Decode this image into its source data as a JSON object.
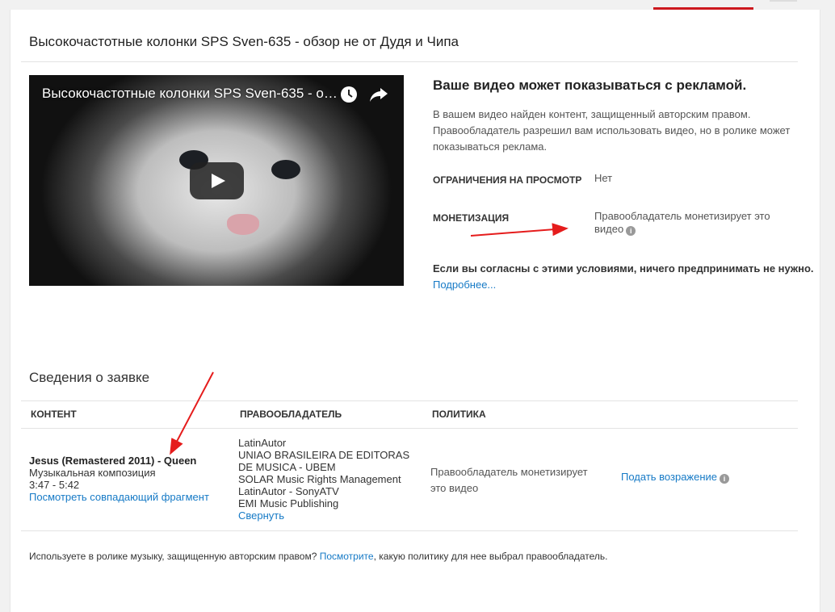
{
  "page": {
    "title": "Высокочастотные колонки SPS Sven-635 - обзор не от Дудя и Чипа"
  },
  "video": {
    "title": "Высокочастотные колонки SPS Sven-635 - обзор не от Дудя и Чипа",
    "icons": [
      "clock-icon",
      "share-icon",
      "play-icon"
    ]
  },
  "ad_notice": {
    "heading": "Ваше видео может показываться с рекламой.",
    "description": "В вашем видео найден контент, защищенный авторским правом. Правообладатель разрешил вам использовать видео, но в ролике может показываться реклама.",
    "restrictions_label": "ОГРАНИЧЕНИЯ НА ПРОСМОТР",
    "restrictions_value": "Нет",
    "monetization_label": "МОНЕТИЗАЦИЯ",
    "monetization_value": "Правообладатель монетизирует это видео",
    "agree_text": "Если вы согласны с этими условиями, ничего предпринимать не нужно.",
    "more_link": "Подробнее..."
  },
  "claim": {
    "section_title": "Сведения о заявке",
    "headers": {
      "content": "КОНТЕНТ",
      "owner": "ПРАВООБЛАДАТЕЛЬ",
      "policy": "ПОЛИТИКА"
    },
    "row": {
      "content_title": "Jesus (Remastered 2011) - Queen",
      "content_type": "Музыкальная композиция",
      "content_range": "3:47 - 5:42",
      "content_link": "Посмотреть совпадающий фрагмент",
      "owners": [
        "LatinAutor",
        "UNIAO BRASILEIRA DE EDITORAS DE MUSICA - UBEM",
        "SOLAR Music Rights Management",
        "LatinAutor - SonyATV",
        "EMI Music Publishing"
      ],
      "collapse_link": "Свернуть",
      "policy": "Правообладатель монетизирует это видео",
      "dispute_link": "Подать возражение"
    }
  },
  "footer": {
    "text_before": "Используете в ролике музыку, защищенную авторским правом? ",
    "link": "Посмотрите",
    "text_after": ", какую политику для нее выбрал правообладатель."
  },
  "colors": {
    "link": "#167ac6",
    "annotation_arrow": "#e51c1c",
    "tab_underline": "#cc181e"
  }
}
